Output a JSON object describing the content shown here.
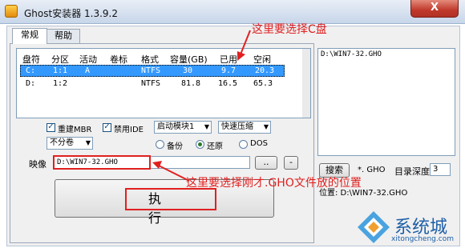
{
  "window": {
    "title": "Ghost安装器 1.3.9.2",
    "close_label": "X"
  },
  "tabs": [
    {
      "label": "常规"
    },
    {
      "label": "帮助"
    }
  ],
  "disk_table": {
    "columns": [
      "盘符",
      "分区",
      "活动",
      "卷标",
      "格式",
      "容量(GB)",
      "已用",
      "空闲"
    ],
    "rows": [
      [
        "C:",
        "1:1",
        "A",
        "",
        "NTFS",
        "30",
        "9.7",
        "20.3"
      ],
      [
        "D:",
        "1:2",
        "",
        "",
        "NTFS",
        "81.8",
        "16.5",
        "65.3"
      ]
    ]
  },
  "options": {
    "rebuild_mbr": {
      "label": "重建MBR",
      "checked": true
    },
    "disable_ide": {
      "label": "禁用IDE",
      "checked": true
    },
    "boot_module": "启动模块1",
    "compression": "快速压缩",
    "split": "不分卷",
    "mode_backup": "备份",
    "mode_restore": "还原",
    "mode_dos": "DOS",
    "selected_mode": "还原"
  },
  "image": {
    "label": "映像",
    "value": "D:\\WIN7-32.GHO",
    "browse_label": "..",
    "minus_label": "-"
  },
  "execute_label": "执行",
  "right_panel": {
    "list_item": "D:\\WIN7-32.GHO",
    "search_label": "搜索",
    "ext_value": "*. GHO",
    "depth_label": "目录深度",
    "depth_value": "3",
    "location_text": "位置: D:\\WIN7-32.GHO"
  },
  "annotations": {
    "select_c": "这里要选择C盘",
    "select_gho": "这里要选择刚才.GHO文件放的位置"
  },
  "watermark": {
    "text": "系统城",
    "url": "xitongcheng.com"
  },
  "colors": {
    "accent": "#3399ff",
    "annotation": "#e02020",
    "watermark": "#1e5fa8"
  }
}
